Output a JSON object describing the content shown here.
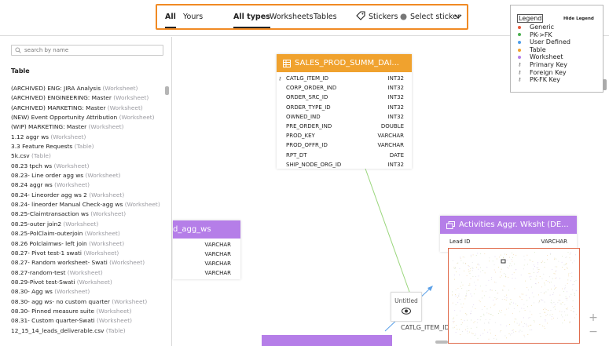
{
  "filters": {
    "owner_tabs": [
      {
        "label": "All",
        "active": true
      },
      {
        "label": "Yours",
        "active": false
      }
    ],
    "type_tabs": [
      {
        "label": "All types",
        "active": true
      },
      {
        "label": "Worksheets",
        "active": false
      },
      {
        "label": "Tables",
        "active": false
      }
    ],
    "stickers_label": "Stickers",
    "select_sticker_label": "Select sticker"
  },
  "sidebar": {
    "search_placeholder": "search by name",
    "heading": "Table",
    "items": [
      {
        "name": "(ARCHIVED) ENG: JIRA Analysis",
        "type": "(Worksheet)"
      },
      {
        "name": "(ARCHIVED) ENGINEERING: Master",
        "type": "(Worksheet)"
      },
      {
        "name": "(ARCHIVED) MARKETING: Master",
        "type": "(Worksheet)"
      },
      {
        "name": "(NEW) Event Opportunity Attribution",
        "type": "(Worksheet)"
      },
      {
        "name": "(WIP) MARKETING: Master",
        "type": "(Worksheet)"
      },
      {
        "name": "1.12 aggr ws",
        "type": "(Worksheet)"
      },
      {
        "name": "3.3 Feature Requests",
        "type": "(Table)"
      },
      {
        "name": "5k.csv",
        "type": "(Table)"
      },
      {
        "name": "08.23 tpch ws",
        "type": "(Worksheet)"
      },
      {
        "name": "08.23- Line order agg ws",
        "type": "(Worksheet)"
      },
      {
        "name": "08.24 aggr ws",
        "type": "(Worksheet)"
      },
      {
        "name": "08.24- Lineorder agg ws 2",
        "type": "(Worksheet)"
      },
      {
        "name": "08.24- lineorder Manual Check-agg ws",
        "type": "(Worksheet)"
      },
      {
        "name": "08.25-Claimtransaction ws",
        "type": "(Worksheet)"
      },
      {
        "name": "08.25-outer join2",
        "type": "(Worksheet)"
      },
      {
        "name": "08.25-PolClaim-outerjoin",
        "type": "(Worksheet)"
      },
      {
        "name": "08.26 Polclaimws- left join",
        "type": "(Worksheet)"
      },
      {
        "name": "08.27- Pivot test-1 swati",
        "type": "(Worksheet)"
      },
      {
        "name": "08.27- Random worksheet- Swati",
        "type": "(Worksheet)"
      },
      {
        "name": "08.27-random-test",
        "type": "(Worksheet)"
      },
      {
        "name": "08.29-Pivot test-Swati",
        "type": "(Worksheet)"
      },
      {
        "name": "08.30- Agg ws",
        "type": "(Worksheet)"
      },
      {
        "name": "08.30- agg ws- no custom quarter",
        "type": "(Worksheet)"
      },
      {
        "name": "08.30- Pinned measure suite",
        "type": "(Worksheet)"
      },
      {
        "name": "08.31- Custom quarter-Swati",
        "type": "(Worksheet)"
      },
      {
        "name": "12_15_14_leads_deliverable.csv",
        "type": "(Table)"
      }
    ]
  },
  "sales_card": {
    "title": "SALES_PROD_SUMM_DAI...",
    "header_color": "#f0a22e",
    "rows": [
      {
        "name": "CATLG_ITEM_ID",
        "type": "INT32",
        "key": true
      },
      {
        "name": "CORP_ORDER_IND",
        "type": "INT32",
        "key": false
      },
      {
        "name": "ORDER_SRC_ID",
        "type": "INT32",
        "key": false
      },
      {
        "name": "ORDER_TYPE_ID",
        "type": "INT32",
        "key": false
      },
      {
        "name": "OWNED_IND",
        "type": "INT32",
        "key": false
      },
      {
        "name": "PRE_ORDER_IND",
        "type": "DOUBLE",
        "key": false
      },
      {
        "name": "PROD_KEY",
        "type": "VARCHAR",
        "key": false
      },
      {
        "name": "PROD_OFFR_ID",
        "type": "VARCHAR",
        "key": false
      },
      {
        "name": "RPT_DT",
        "type": "DATE",
        "key": false
      },
      {
        "name": "SHIP_NODE_ORG_ID",
        "type": "INT32",
        "key": false
      }
    ]
  },
  "agg_card": {
    "title": "d_agg_ws",
    "header_color": "#b57ee8",
    "rows": [
      {
        "type": "VARCHAR"
      },
      {
        "type": "VARCHAR"
      },
      {
        "type": "VARCHAR"
      },
      {
        "type": "VARCHAR"
      }
    ]
  },
  "activities_card": {
    "title": "Activities Aggr. Wksht (DE...",
    "header_color": "#b57ee8",
    "rows": [
      {
        "name": "Lead ID",
        "type": "VARCHAR"
      }
    ]
  },
  "partial_labels": {
    "catlg": "CATLG_ITEM_ID"
  },
  "untitled_label": "Untitled",
  "legend": {
    "title": "Legend",
    "hide_label": "Hide Legend",
    "items": [
      {
        "label": "Generic",
        "color": "#e85a3c",
        "kind": "dot"
      },
      {
        "label": "PK->FK",
        "color": "#4caf50",
        "kind": "dot"
      },
      {
        "label": "User Defined",
        "color": "#4f9de8",
        "kind": "dot"
      },
      {
        "label": "Table",
        "color": "#f0a22e",
        "kind": "dot"
      },
      {
        "label": "Worksheet",
        "color": "#b57ee8",
        "kind": "dot"
      },
      {
        "label": "Primary Key",
        "icon": "primary-key-icon",
        "kind": "key"
      },
      {
        "label": "Foreign Key",
        "icon": "foreign-key-icon",
        "kind": "key"
      },
      {
        "label": "PK-FK Key",
        "icon": "pk-fk-key-icon",
        "kind": "key"
      }
    ]
  },
  "zoom": {
    "plus": "+",
    "minus": "−"
  }
}
